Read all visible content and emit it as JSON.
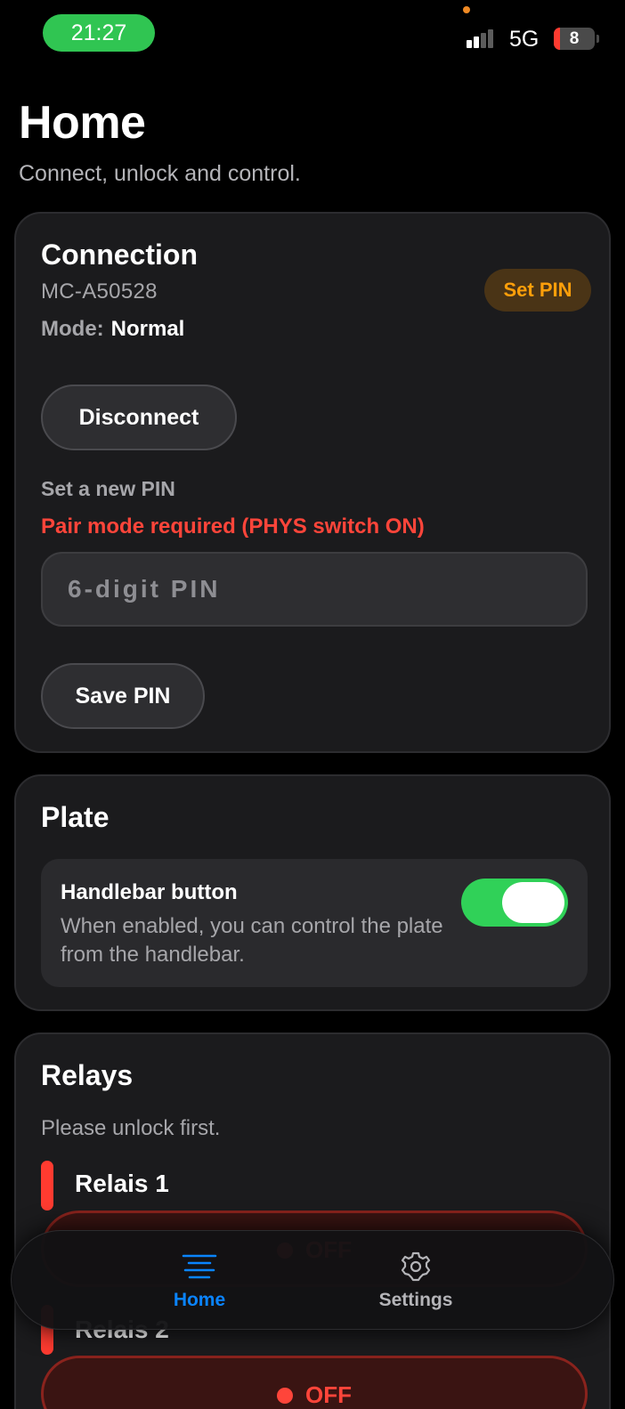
{
  "status_bar": {
    "time": "21:27",
    "network": "5G",
    "battery": "8"
  },
  "header": {
    "title": "Home",
    "subtitle": "Connect, unlock and control."
  },
  "connection": {
    "title": "Connection",
    "device_id": "MC-A50528",
    "mode_label": "Mode:",
    "mode_value": "Normal",
    "set_pin_badge": "Set PIN",
    "disconnect_label": "Disconnect",
    "new_pin_label": "Set a new PIN",
    "pair_warning": "Pair mode required (PHYS switch ON)",
    "pin_placeholder": "6-digit PIN",
    "save_pin_label": "Save PIN"
  },
  "plate": {
    "title": "Plate",
    "handlebar_title": "Handlebar button",
    "handlebar_desc": "When enabled, you can control the plate from the handlebar.",
    "handlebar_enabled": true
  },
  "relays": {
    "title": "Relays",
    "note": "Please unlock first.",
    "items": [
      {
        "name": "Relais 1",
        "state": "OFF"
      },
      {
        "name": "Relais 2",
        "state": "OFF"
      }
    ]
  },
  "tabbar": {
    "items": [
      {
        "label": "Home",
        "icon": "menu-lines-icon",
        "active": true
      },
      {
        "label": "Settings",
        "icon": "gear-icon",
        "active": false
      }
    ]
  },
  "colors": {
    "accent_blue": "#0a84ff",
    "danger_red": "#ff453a",
    "warning_orange": "#ff9f0a",
    "toggle_green": "#30d158",
    "status_green": "#30c552"
  }
}
